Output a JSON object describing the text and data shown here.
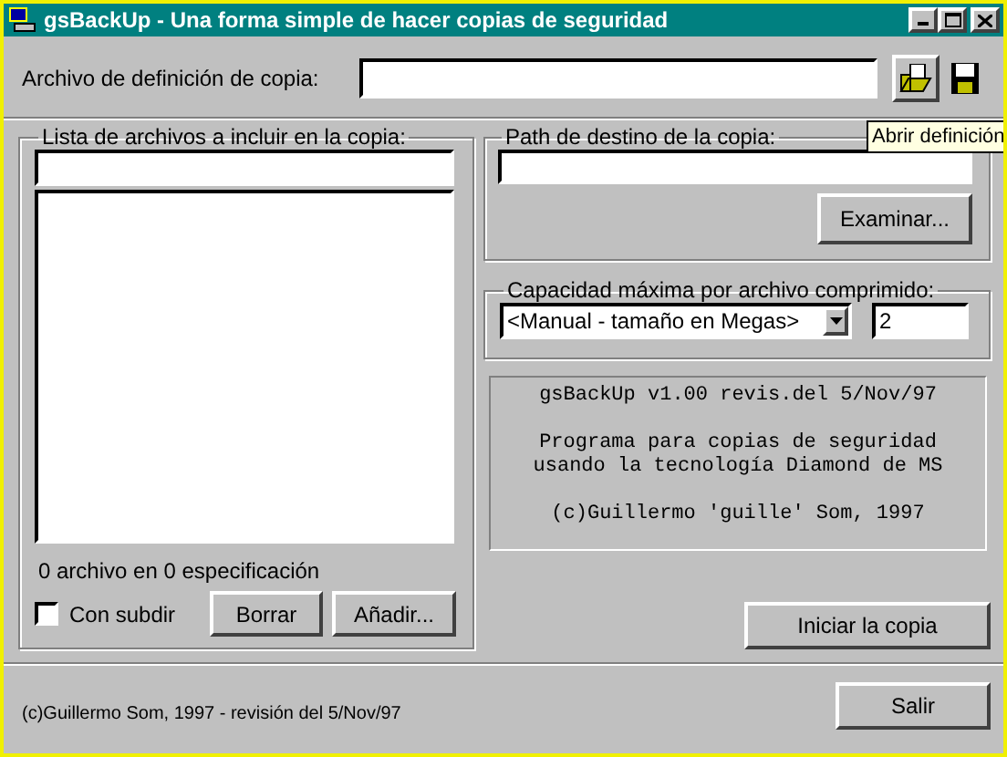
{
  "window": {
    "title": "gsBackUp - Una forma simple de hacer copias de seguridad"
  },
  "definition": {
    "label": "Archivo de definición de copia:"
  },
  "tooltip": "Abrir definición",
  "file_list": {
    "title": "Lista de archivos a incluir en la copia:",
    "summary": "0 archivo en 0 especificación",
    "subdirs": {
      "label": "Con subdir",
      "checked": false
    },
    "buttons": [
      "Borrar",
      "Añadir..."
    ]
  },
  "destination": {
    "title": "Path de destino de la copia:",
    "button": "Examinar..."
  },
  "capacity": {
    "title": "Capacidad máxima por archivo comprimido:",
    "select": "<Manual - tamaño en Megas>",
    "value": "2"
  },
  "info": [
    "gsBackUp v1.00 revis.del 5/Nov/97",
    "Programa para copias de seguridad",
    "usando la tecnología Diamond de MS",
    "(c)Guillermo 'guille' Som, 1997"
  ],
  "start_button": "Iniciar la copia",
  "exit_button": "Salir",
  "footer": "(c)Guillermo Som, 1997 - revisión del 5/Nov/97"
}
